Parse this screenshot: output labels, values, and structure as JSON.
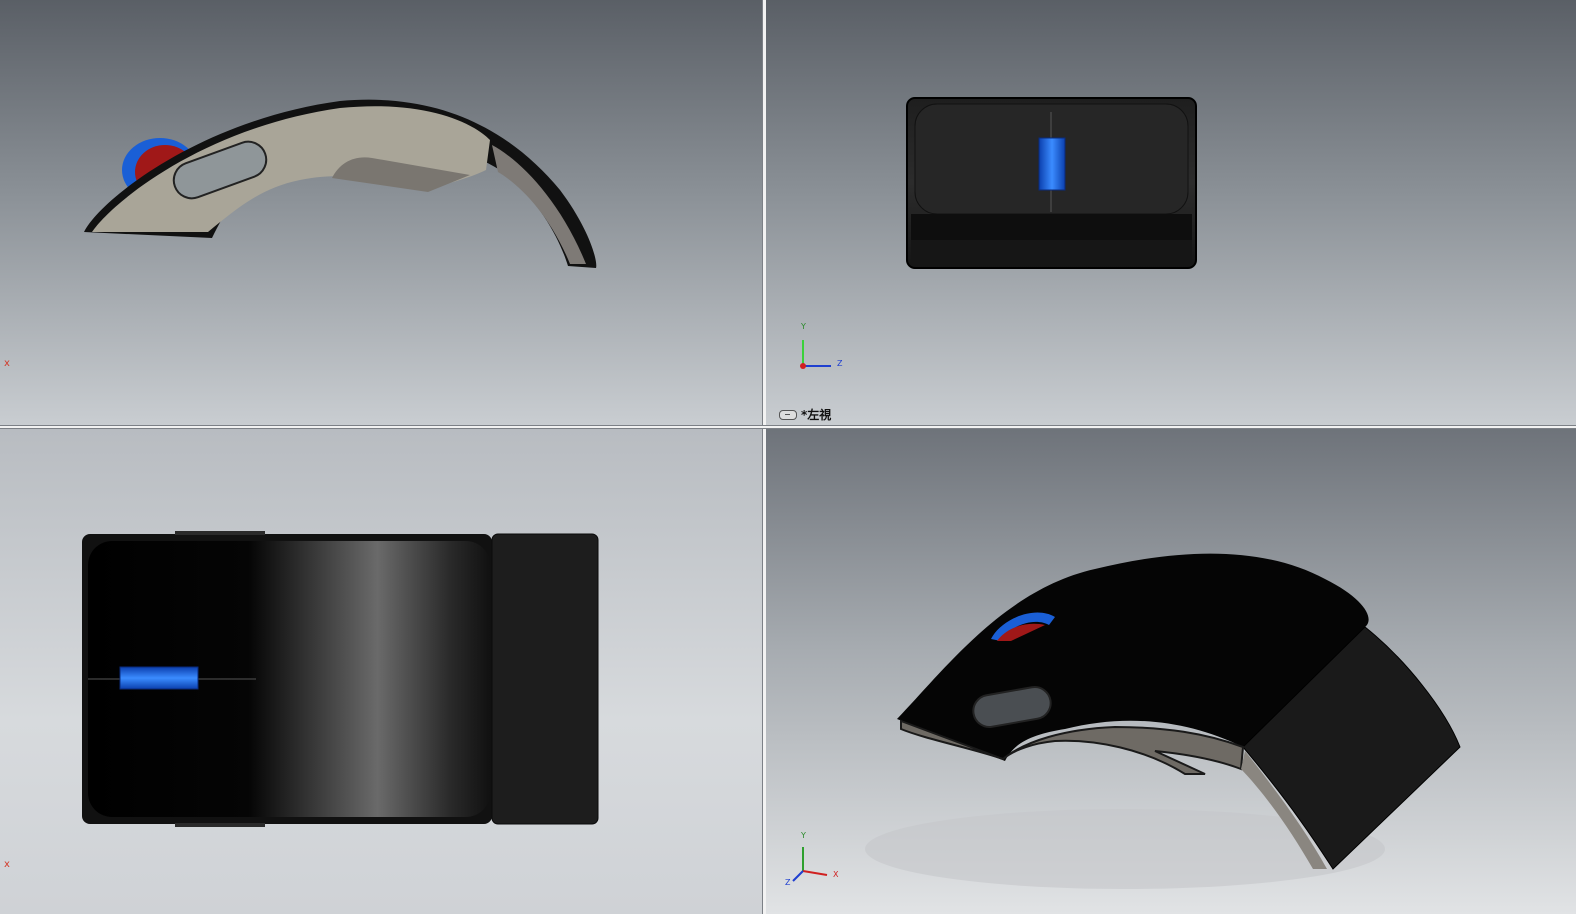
{
  "viewports": {
    "top_left": {
      "origin_mark": "x"
    },
    "top_right": {
      "view_label": "*左視",
      "triad": {
        "y": "Y",
        "z": "Z"
      }
    },
    "bottom_left": {
      "origin_mark": "x"
    },
    "bottom_right": {
      "triad": {
        "y": "Y",
        "x": "X",
        "z": "Z"
      }
    }
  },
  "colors": {
    "body_black": "#0a0a0a",
    "side_panel": "#a9a598",
    "inner_gray": "#7a7670",
    "wheel_blue": "#1a5fd6",
    "wheel_red": "#a01818"
  }
}
